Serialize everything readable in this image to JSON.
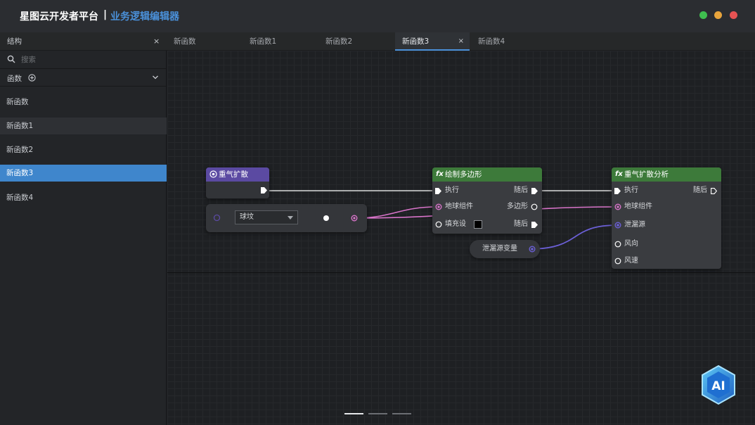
{
  "window": {
    "app_title": "星图云开发者平台",
    "separator": "|",
    "section_title": "业务逻辑编辑器",
    "controls": {
      "min_color": "#3fbf4f",
      "max_color": "#e8a43c",
      "close_color": "#e65353"
    }
  },
  "panel": {
    "title": "结构",
    "close": "×"
  },
  "search": {
    "placeholder": "搜索"
  },
  "functions": {
    "section_label": "函数",
    "items": [
      {
        "label": "新函数"
      },
      {
        "label": "新函数1"
      },
      {
        "label": "新函数2"
      },
      {
        "label": "新函数3"
      },
      {
        "label": "新函数4"
      }
    ]
  },
  "tabs": [
    {
      "label": "新函数"
    },
    {
      "label": "新函数1"
    },
    {
      "label": "新函数2"
    },
    {
      "label": "新函数3",
      "close": "×"
    },
    {
      "label": "新函数4"
    }
  ],
  "nodes": {
    "event": {
      "title": "重气扩散",
      "dropdown_value": "球坟"
    },
    "draw_polygon": {
      "title": "绘制多边形",
      "fx": "fx",
      "exec_in": "执行",
      "exec_out": "随后",
      "ball_component": "地球组件",
      "polygon_out": "多边形",
      "fill_setting": "填充设",
      "then_out": "随后"
    },
    "analysis": {
      "title": "重气扩散分析",
      "fx": "fx",
      "exec_in": "执行",
      "exec_out": "随后",
      "ball_component": "地球组件",
      "leak_source": "泄漏源",
      "wind_direction": "风向",
      "wind_speed": "风速"
    },
    "variable": {
      "label": "泄漏源变量"
    }
  },
  "badge": {
    "text": "AI"
  },
  "colors": {
    "accent": "#4a90d9",
    "exec_wire": "#ffffff",
    "pink_wire": "#d874c9",
    "blue_wire": "#6b5fd6",
    "event_header": "#5b4aa2",
    "function_header": "#3d7a3a"
  }
}
